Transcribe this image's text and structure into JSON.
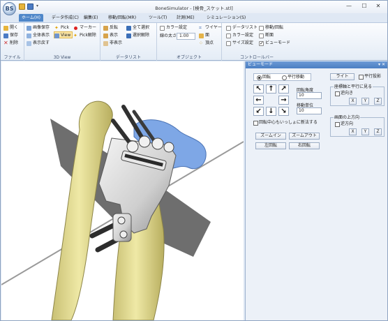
{
  "window": {
    "app_logo": "BS",
    "title": "BoneSimulator - [検骨_スケット.stl]",
    "minimize": "—",
    "maximize": "☐",
    "close": "✕",
    "quick_access_dropdown": "▾"
  },
  "tabs": [
    {
      "label": "ホーム(H)",
      "active": true
    },
    {
      "label": "データ作成(C)"
    },
    {
      "label": "編集(E)"
    },
    {
      "label": "移動/回転(MR)"
    },
    {
      "label": "ツール(T)"
    },
    {
      "label": "計測(ME)"
    },
    {
      "label": "シミュレーション(S)"
    }
  ],
  "ribbon": {
    "file": {
      "label": "ファイル",
      "open": "開く",
      "save": "保存",
      "delete": "削除"
    },
    "view3d": {
      "label": "3D View",
      "save_image": "画像保存",
      "pick": "Pick",
      "marker": "マーカー",
      "show_all": "全体表示",
      "view": "View",
      "pick_release": "Pick解除",
      "show_back": "表示戻す"
    },
    "datalist": {
      "label": "データリスト",
      "invert": "反転",
      "select_all": "全て選択",
      "show": "表示",
      "deselect": "選択解除",
      "hide": "非表示"
    },
    "object": {
      "label": "オブジェクト",
      "color_setting": "カラー設定",
      "wire": "ワイヤー",
      "line_width": "線の太さ",
      "line_width_value": "1.00",
      "face": "面",
      "vertex": "頂点"
    },
    "control": {
      "label": "コントロールバー",
      "datalist": "データリスト",
      "move_rotate": "移動/回転",
      "color_setting": "カラー設定",
      "section": "断面",
      "size_setting": "サイズ設定",
      "view_mode": "ビューモード"
    }
  },
  "panel": {
    "header": "ビューモード",
    "header_controls": "▾ ✕",
    "rotate_label": "回転",
    "translate_label": "平行移動",
    "arrows": {
      "up_left": "↖",
      "up": "↑",
      "up_right": "↗",
      "left": "←",
      "right": "→",
      "down_left": "↙",
      "down": "↓",
      "down_right": "↘"
    },
    "rotation_angle_label": "回転角度",
    "rotation_angle_value": "10",
    "move_unit_label": "移動単位",
    "move_unit_value": "10",
    "rotate_center_check": "回転中心もいっしょに新法する",
    "zoom_in": "ズームイン",
    "zoom_out": "ズームアウト",
    "rotate_left": "左回転",
    "rotate_right": "右回転",
    "light": "ライト",
    "parallel_projection": "平行投影",
    "view_along_axis_title": "座標軸と平行に見る",
    "view_along_axis_reverse": "逆向き",
    "screen_up_title": "画面の上方向",
    "screen_up_reverse": "逆方向",
    "axis_x": "X",
    "axis_y": "Y",
    "axis_z": "Z"
  }
}
